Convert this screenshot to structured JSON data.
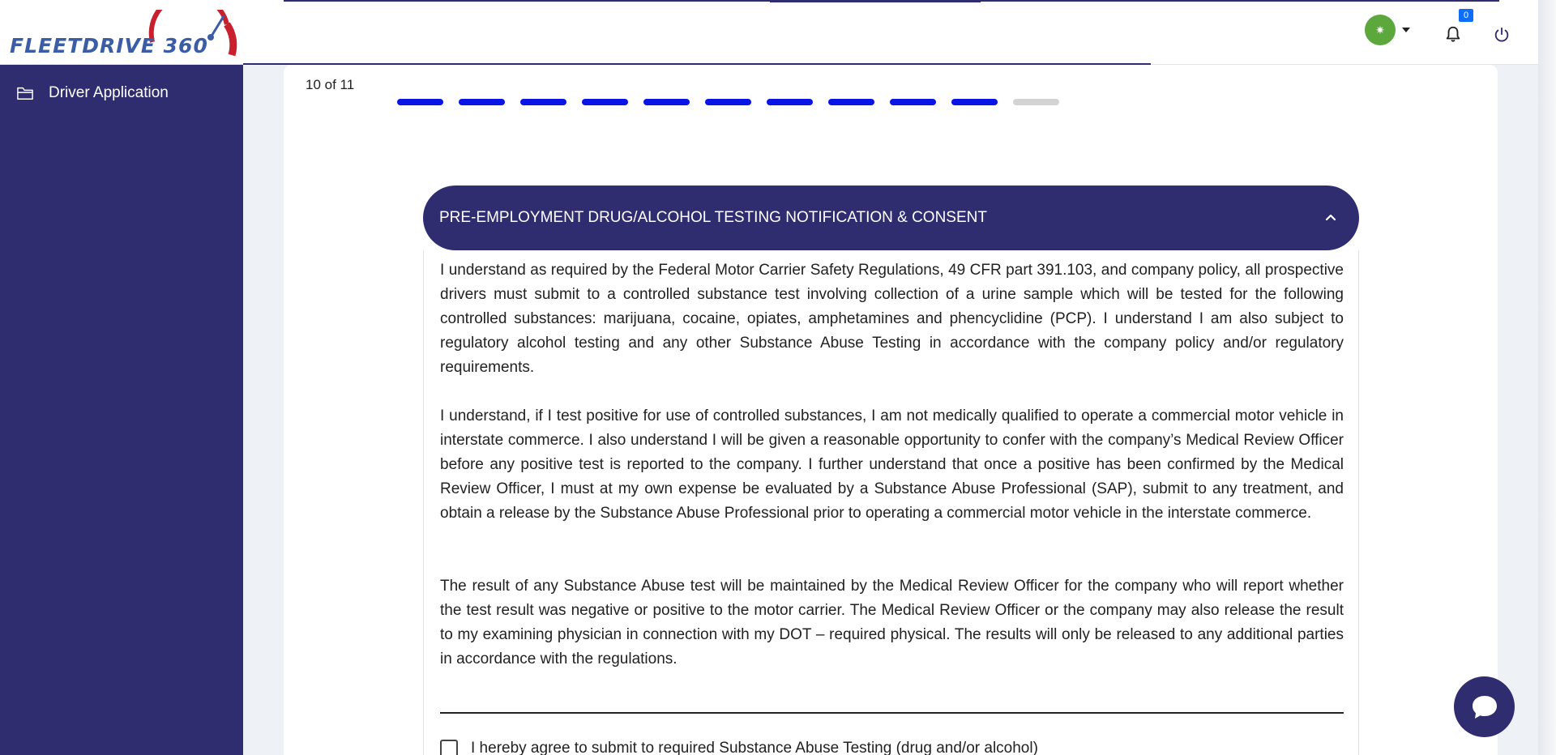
{
  "app": {
    "logo_text": "FLEETDRIVE 360",
    "brand_color": "#2f2d70",
    "accent_color": "#0a14e6"
  },
  "header": {
    "avatar_glyph": "✷",
    "notifications_count": "0",
    "icons": [
      "bell-icon",
      "power-icon",
      "chevron-down-icon"
    ]
  },
  "sidebar": {
    "items": [
      {
        "label": "Driver Application",
        "icon": "folder-icon"
      }
    ]
  },
  "progress": {
    "label": "10 of 11",
    "current_step": 10,
    "total_steps": 11
  },
  "section": {
    "title": "PRE-EMPLOYMENT DRUG/ALCOHOL TESTING NOTIFICATION & CONSENT",
    "expanded": true,
    "paragraphs": [
      "I understand as required by the Federal Motor Carrier Safety Regulations, 49 CFR part 391.103, and company policy, all prospective drivers must submit to a controlled substance test involving collection of a urine sample which will be tested for the following controlled substances: marijuana, cocaine, opiates, amphetamines and phencyclidine (PCP). I understand I am also subject to regulatory alcohol testing and any other Substance Abuse Testing in accordance with the company policy and/or regulatory requirements.",
      "I understand, if I test positive for use of controlled substances, I am not medically qualified to operate a commercial motor vehicle in interstate commerce. I also understand I will be given a reasonable opportunity to confer with the company’s Medical Review Officer before any positive test is reported to the company. I further understand that once a positive has been confirmed by the Medical Review Officer, I must at my own expense be evaluated by a Substance Abuse Professional (SAP), submit to any treatment, and obtain a release by the Substance Abuse Professional prior to operating a commercial motor vehicle in the interstate commerce.",
      "The result of any Substance Abuse test will be maintained by the Medical Review Officer for the company who will report whether the test result was negative or positive to the motor carrier. The Medical Review Officer or the company may also release the result to my examining physician in connection with my DOT – required physical. The results will only be released to any additional parties in accordance with the regulations."
    ],
    "agree_label": "I hereby agree to submit to required Substance Abuse Testing (drug and/or alcohol)",
    "agree_checked": false
  },
  "chat": {
    "icon": "chat-icon"
  }
}
